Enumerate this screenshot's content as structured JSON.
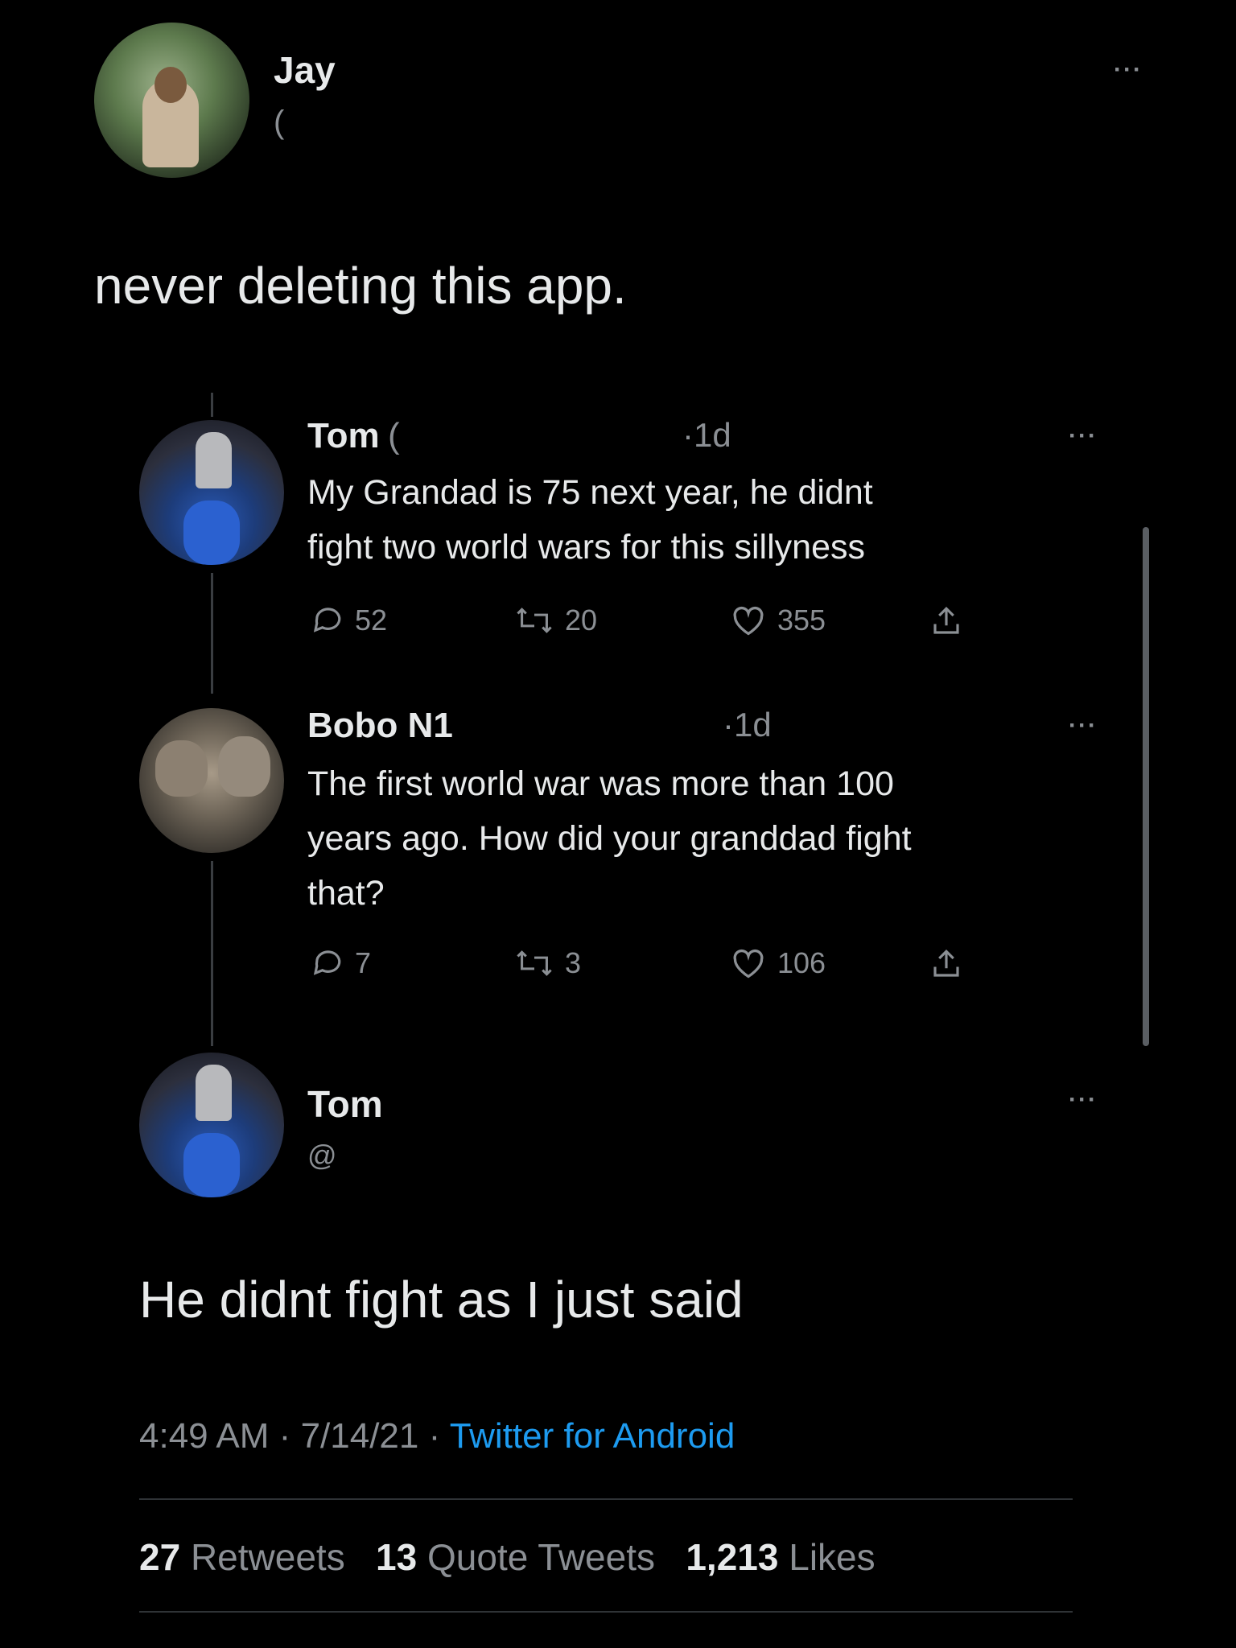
{
  "header": {
    "author_name": "Jay",
    "author_handle_fragment": "("
  },
  "main_tweet": {
    "text": "never deleting this app."
  },
  "quoted": [
    {
      "name": "Tom",
      "handle_fragment": "(",
      "time": "1d",
      "text_lines": [
        "My Grandad is 75 next year,  he didnt",
        "fight two world wars for this sillyness"
      ],
      "replies": "52",
      "retweets": "20",
      "likes": "355"
    },
    {
      "name": "Bobo N1",
      "time": "1d",
      "text_lines": [
        "The first world war was more than 100",
        "years ago. How did your granddad fight",
        "that?"
      ],
      "replies": "7",
      "retweets": "3",
      "likes": "106"
    }
  ],
  "reply": {
    "name": "Tom",
    "handle_fragment": "@",
    "text": "He didnt fight as I just said"
  },
  "meta": {
    "time": "4:49 AM",
    "sep1": "·",
    "date": "7/14/21",
    "sep2": "·",
    "source": "Twitter for Android"
  },
  "stats": {
    "retweets_count": "27",
    "retweets_label": "Retweets",
    "quotes_count": "13",
    "quotes_label": "Quote Tweets",
    "likes_count": "1,213",
    "likes_label": "Likes"
  },
  "colors": {
    "link": "#1d9bf0",
    "background": "#000000"
  }
}
